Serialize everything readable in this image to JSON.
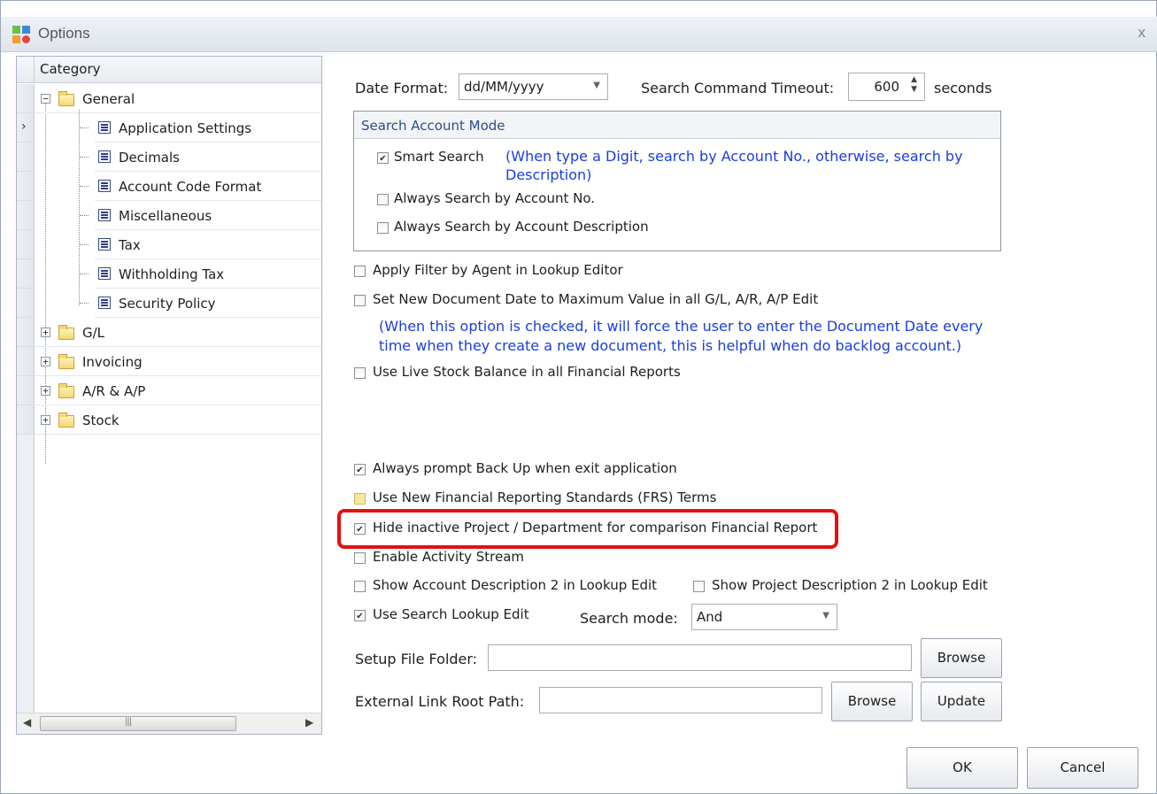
{
  "window": {
    "title": "Options",
    "close_glyph": "x"
  },
  "category": {
    "header": "Category",
    "items": [
      {
        "label": "General",
        "type": "folder",
        "expanded": true
      },
      {
        "label": "Application Settings",
        "type": "page",
        "selected": true
      },
      {
        "label": "Decimals",
        "type": "page"
      },
      {
        "label": "Account Code Format",
        "type": "page"
      },
      {
        "label": "Miscellaneous",
        "type": "page"
      },
      {
        "label": "Tax",
        "type": "page"
      },
      {
        "label": "Withholding Tax",
        "type": "page"
      },
      {
        "label": "Security Policy",
        "type": "page"
      },
      {
        "label": "G/L",
        "type": "folder",
        "expanded": false
      },
      {
        "label": "Invoicing",
        "type": "folder",
        "expanded": false
      },
      {
        "label": "A/R & A/P",
        "type": "folder",
        "expanded": false
      },
      {
        "label": "Stock",
        "type": "folder",
        "expanded": false
      }
    ],
    "scroll_grip": "|||"
  },
  "settings": {
    "date_format_label": "Date Format:",
    "date_format_value": "dd/MM/yyyy",
    "timeout_label": "Search Command Timeout:",
    "timeout_value": "600",
    "timeout_unit": "seconds",
    "search_mode_group": {
      "title": "Search Account Mode",
      "smart_search": {
        "label": "Smart Search",
        "checked": true
      },
      "smart_note_1": "(When type a Digit, search by Account No., otherwise, search by",
      "smart_note_2": "Description)",
      "by_account_no": {
        "label": "Always Search by Account No.",
        "checked": false
      },
      "by_account_desc": {
        "label": "Always Search by Account Description",
        "checked": false
      }
    },
    "apply_filter_agent": {
      "label": "Apply Filter by Agent in Lookup Editor",
      "checked": false
    },
    "set_new_doc_date": {
      "label": "Set New Document Date to Maximum Value in all G/L, A/R, A/P Edit",
      "checked": false
    },
    "doc_date_note_1": "(When this option is checked, it will force the user to enter the Document Date every",
    "doc_date_note_2": "time when they create a new document, this is helpful when do backlog account.)",
    "live_stock_balance": {
      "label": "Use Live Stock Balance in all Financial Reports",
      "checked": false
    },
    "prompt_backup": {
      "label": "Always prompt Back Up when exit application",
      "checked": true
    },
    "new_frs_terms": {
      "label": "Use New Financial Reporting Standards (FRS) Terms",
      "checked": false
    },
    "hide_inactive_project": {
      "label": "Hide inactive Project / Department for comparison Financial Report",
      "checked": true
    },
    "activity_stream": {
      "label": "Enable Activity Stream",
      "checked": false
    },
    "account_desc2": {
      "label": "Show Account Description 2 in Lookup Edit",
      "checked": false
    },
    "project_desc2": {
      "label": "Show Project Description 2 in Lookup Edit",
      "checked": false
    },
    "search_lookup_edit": {
      "label": "Use Search Lookup Edit",
      "checked": true
    },
    "search_mode_label": "Search mode:",
    "search_mode_value": "And",
    "setup_folder_label": "Setup File Folder:",
    "setup_folder_value": "",
    "external_link_label": "External Link Root Path:",
    "external_link_value": "",
    "browse_label": "Browse",
    "update_label": "Update"
  },
  "footer": {
    "ok_label": "OK",
    "cancel_label": "Cancel"
  },
  "colors": {
    "note_blue": "#1a3de0",
    "highlight_red": "#e60f0f"
  }
}
